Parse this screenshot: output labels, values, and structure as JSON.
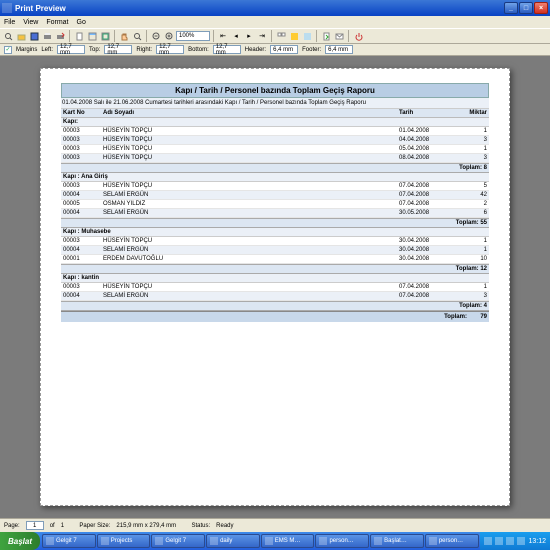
{
  "window": {
    "title": "Print Preview"
  },
  "menu": {
    "file": "File",
    "view": "View",
    "format": "Format",
    "go": "Go"
  },
  "toolbar": {
    "zoom": "100%"
  },
  "margins": {
    "label": "Margins",
    "left_l": "Left:",
    "left": "12,7 mm",
    "top_l": "Top:",
    "top": "12,7 mm",
    "right_l": "Right:",
    "right": "12,7 mm",
    "bottom_l": "Bottom:",
    "bottom": "12,7 mm",
    "header_l": "Header:",
    "header": "6,4 mm",
    "footer_l": "Footer:",
    "footer": "6,4 mm"
  },
  "report": {
    "title": "Kapı / Tarih / Personel bazında Toplam Geçiş Raporu",
    "subtitle": "01.04.2008 Salı ile 21.06.2008 Cumartesi tarihleri arasındaki Kapı / Tarih / Personel bazında Toplam Geçiş Raporu",
    "cols": {
      "c1": "Kart No",
      "c2": "Adı Soyadı",
      "c3": "Tarih",
      "c4": "Miktar"
    },
    "groups": [
      {
        "name": "Kapı:",
        "total_label": "Toplam: 8",
        "rows": [
          {
            "no": "00003",
            "ad": "HÜSEYİN TOPÇU",
            "t": "01.04.2008",
            "m": "1"
          },
          {
            "no": "00003",
            "ad": "HÜSEYİN TOPÇU",
            "t": "04.04.2008",
            "m": "3"
          },
          {
            "no": "00003",
            "ad": "HÜSEYİN TOPÇU",
            "t": "05.04.2008",
            "m": "1"
          },
          {
            "no": "00003",
            "ad": "HÜSEYİN TOPÇU",
            "t": "08.04.2008",
            "m": "3"
          }
        ]
      },
      {
        "name": "Kapı : Ana Giriş",
        "total_label": "Toplam: 55",
        "rows": [
          {
            "no": "00003",
            "ad": "HÜSEYİN TOPÇU",
            "t": "07.04.2008",
            "m": "5"
          },
          {
            "no": "00004",
            "ad": "SELAMİ ERGÜN",
            "t": "07.04.2008",
            "m": "42"
          },
          {
            "no": "00005",
            "ad": "OSMAN YILDIZ",
            "t": "07.04.2008",
            "m": "2"
          },
          {
            "no": "00004",
            "ad": "SELAMİ ERGÜN",
            "t": "30.05.2008",
            "m": "6"
          }
        ]
      },
      {
        "name": "Kapı : Muhasebe",
        "total_label": "Toplam: 12",
        "rows": [
          {
            "no": "00003",
            "ad": "HÜSEYİN TOPÇU",
            "t": "30.04.2008",
            "m": "1"
          },
          {
            "no": "00004",
            "ad": "SELAMİ ERGÜN",
            "t": "30.04.2008",
            "m": "1"
          },
          {
            "no": "00001",
            "ad": "ERDEM DAVUTOĞLU",
            "t": "30.04.2008",
            "m": "10"
          }
        ]
      },
      {
        "name": "Kapı : kantin",
        "total_label": "Toplam: 4",
        "rows": [
          {
            "no": "00003",
            "ad": "HÜSEYİN TOPÇU",
            "t": "07.04.2008",
            "m": "1"
          },
          {
            "no": "00004",
            "ad": "SELAMİ ERGÜN",
            "t": "07.04.2008",
            "m": "3"
          }
        ]
      }
    ],
    "grand_label": "Toplam:",
    "grand_value": "79"
  },
  "status": {
    "page_l": "Page:",
    "page": "1",
    "of_l": "of",
    "pages": "1",
    "paper_l": "Paper Size:",
    "paper": "215,9 mm x 279,4 mm",
    "status_l": "Status:",
    "status": "Ready"
  },
  "taskbar": {
    "start": "Başlat",
    "tasks": [
      "Gelgit 7",
      "Projects",
      "Gelgit 7",
      "daily",
      "EMS M…",
      "person…",
      "Başlat…",
      "person…"
    ],
    "clock": "13:12"
  }
}
